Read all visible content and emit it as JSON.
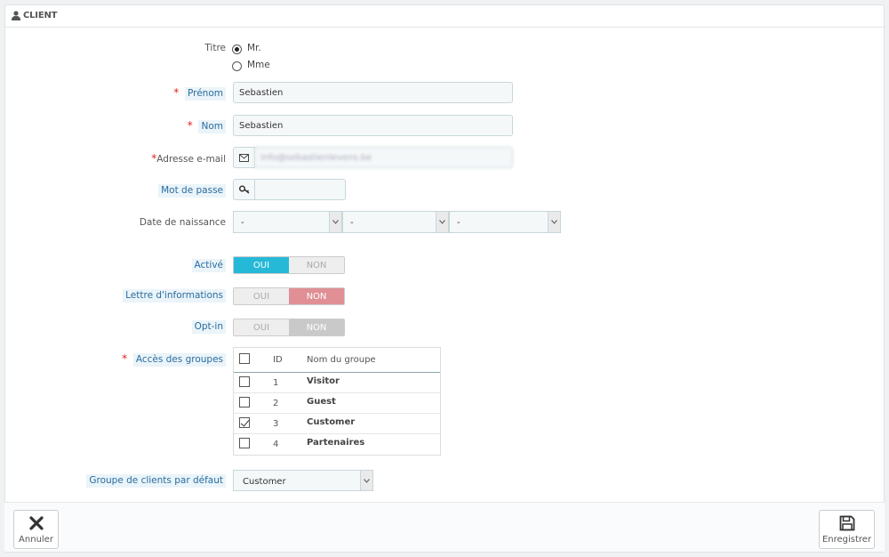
{
  "panel": {
    "title": "CLIENT",
    "icon": "user-icon"
  },
  "form": {
    "titre": {
      "label": "Titre",
      "options": [
        "Mr.",
        "Mme"
      ],
      "selected": "Mr."
    },
    "prenom": {
      "label": "Prénom",
      "required": "*",
      "value": "Sebastien"
    },
    "nom": {
      "label": "Nom",
      "required": "*",
      "value": "Sebastien"
    },
    "email": {
      "label": "Adresse e-mail",
      "required": "*",
      "value": "info@sebastienlevens.be",
      "icon": "envelope-icon"
    },
    "password": {
      "label": "Mot de passe",
      "value": "",
      "icon": "key-icon"
    },
    "birthdate": {
      "label": "Date de naissance",
      "day": "-",
      "month": "-",
      "year": "-"
    },
    "active": {
      "label": "Activé",
      "yes": "OUI",
      "no": "NON",
      "value": "OUI"
    },
    "newsletter": {
      "label": "Lettre d'informations",
      "yes": "OUI",
      "no": "NON",
      "value": "NON"
    },
    "optin": {
      "label": "Opt-in",
      "yes": "OUI",
      "no": "NON",
      "value": "NON"
    },
    "groups": {
      "label": "Accès des groupes",
      "required": "*",
      "columns": {
        "id": "ID",
        "name": "Nom du groupe"
      },
      "rows": [
        {
          "id": "1",
          "name": "Visitor",
          "checked": false
        },
        {
          "id": "2",
          "name": "Guest",
          "checked": false
        },
        {
          "id": "3",
          "name": "Customer",
          "checked": true
        },
        {
          "id": "4",
          "name": "Partenaires",
          "checked": false
        }
      ]
    },
    "default_group": {
      "label": "Groupe de clients par défaut",
      "value": "Customer"
    }
  },
  "footer": {
    "cancel": "Annuler",
    "save": "Enregistrer"
  },
  "colors": {
    "accent": "#25b9d7",
    "danger": "#e08f95",
    "required": "#e2231a",
    "link": "#2b6c9f"
  }
}
